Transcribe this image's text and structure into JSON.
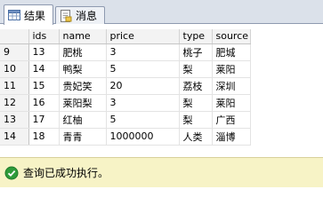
{
  "tabs": [
    {
      "label": "结果",
      "icon": "grid-icon"
    },
    {
      "label": "消息",
      "icon": "message-icon"
    }
  ],
  "grid": {
    "columns": [
      "ids",
      "name",
      "price",
      "type",
      "source"
    ],
    "rows": [
      {
        "rownum": "9",
        "cells": [
          "13",
          "肥桃",
          "3",
          "桃子",
          "肥城"
        ]
      },
      {
        "rownum": "10",
        "cells": [
          "14",
          "鸭梨",
          "5",
          "梨",
          "莱阳"
        ]
      },
      {
        "rownum": "11",
        "cells": [
          "15",
          "贵妃笑",
          "20",
          "荔枝",
          "深圳"
        ]
      },
      {
        "rownum": "12",
        "cells": [
          "16",
          "莱阳梨",
          "3",
          "梨",
          "莱阳"
        ]
      },
      {
        "rownum": "13",
        "cells": [
          "17",
          "红柚",
          "5",
          "梨",
          "广西"
        ]
      },
      {
        "rownum": "14",
        "cells": [
          "18",
          "青青",
          "1000000",
          "人类",
          "淄博"
        ]
      }
    ]
  },
  "status": {
    "text": "查询已成功执行。",
    "icon": "success-check-icon",
    "color": "#2e9b3a"
  }
}
